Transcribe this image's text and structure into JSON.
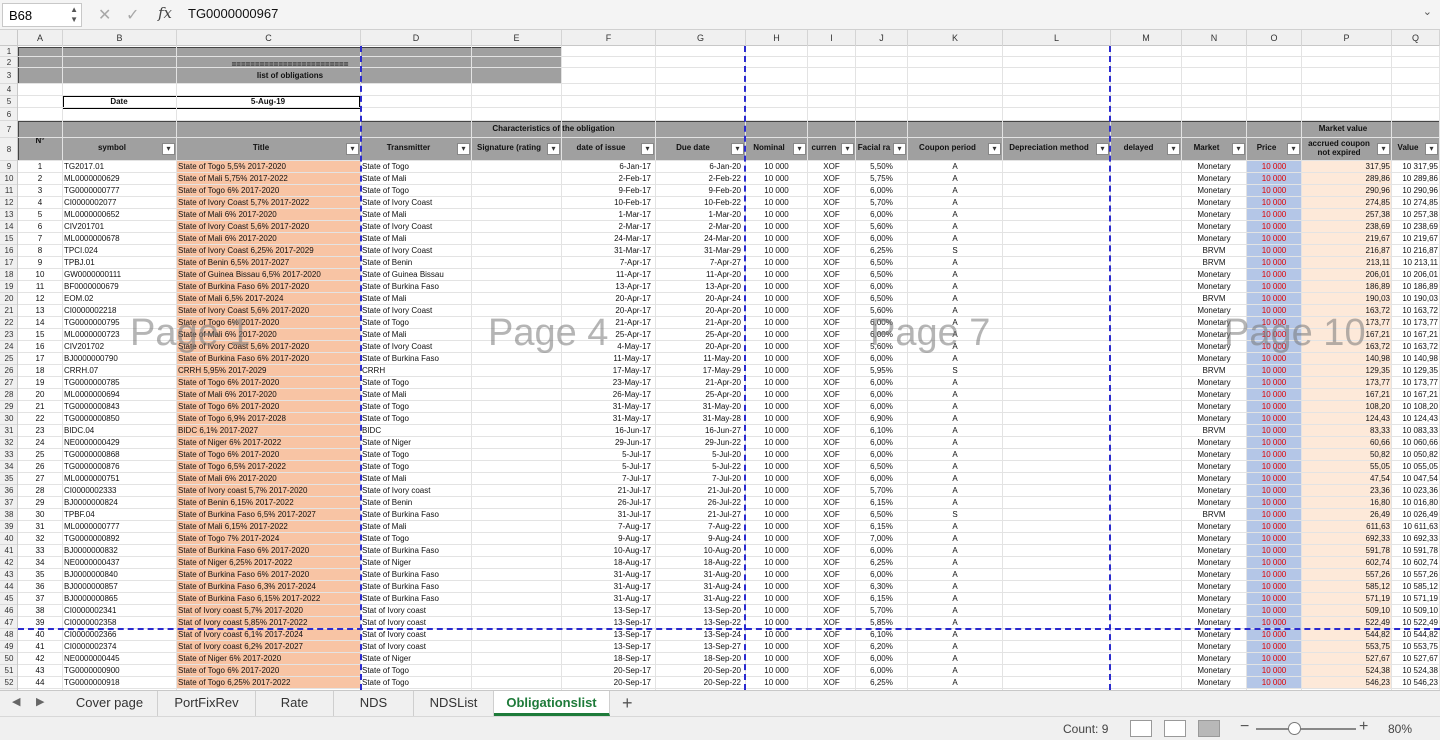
{
  "formula_bar": {
    "cell_ref": "B68",
    "fx_label": "fx",
    "value": "TG0000000967"
  },
  "columns": [
    "A",
    "B",
    "C",
    "D",
    "E",
    "F",
    "G",
    "H",
    "I",
    "J",
    "K",
    "L",
    "M",
    "N",
    "O",
    "P",
    "Q"
  ],
  "first_row": 1,
  "last_row": 52,
  "header": {
    "banner_line": "=========================",
    "banner_title": "list of obligations",
    "date_label": "Date",
    "date_value": "5-Aug-19",
    "no_label": "N°",
    "characteristics": "Characteristics of the obligation",
    "market_value": "Market value",
    "col_labels": [
      "symbol",
      "Title",
      "Transmitter",
      "Signature  (rating",
      "date of issue",
      "Due date",
      "Nominal",
      "curren",
      "Facial ra",
      "Coupon period",
      "Depreciation method",
      "delayed",
      "Market",
      "Price",
      "accrued coupon not expired",
      "Value"
    ]
  },
  "page_watermarks": [
    "Page 1",
    "Page 4",
    "Page 7",
    "Page 10"
  ],
  "rows": [
    [
      "1",
      "TG2017.01",
      "State of Togo 5,5% 2017-2020",
      "State of Togo",
      "6-Jan-17",
      "6-Jan-20",
      "10 000",
      "XOF",
      "5,50%",
      "A",
      "Monetary",
      "10 000",
      "317,95",
      "10 317,95"
    ],
    [
      "2",
      "ML0000000629",
      "State of Mali 5,75% 2017-2022",
      "State of Mali",
      "2-Feb-17",
      "2-Feb-22",
      "10 000",
      "XOF",
      "5,75%",
      "A",
      "Monetary",
      "10 000",
      "289,86",
      "10 289,86"
    ],
    [
      "3",
      "TG0000000777",
      "State of Togo 6% 2017-2020",
      "State of Togo",
      "9-Feb-17",
      "9-Feb-20",
      "10 000",
      "XOF",
      "6,00%",
      "A",
      "Monetary",
      "10 000",
      "290,96",
      "10 290,96"
    ],
    [
      "4",
      "CI0000002077",
      "State of Ivory Coast 5,7% 2017-2022",
      "State of Ivory Coast",
      "10-Feb-17",
      "10-Feb-22",
      "10 000",
      "XOF",
      "5,70%",
      "A",
      "Monetary",
      "10 000",
      "274,85",
      "10 274,85"
    ],
    [
      "5",
      "ML0000000652",
      "State of Mali 6% 2017-2020",
      "State of Mali",
      "1-Mar-17",
      "1-Mar-20",
      "10 000",
      "XOF",
      "6,00%",
      "A",
      "Monetary",
      "10 000",
      "257,38",
      "10 257,38"
    ],
    [
      "6",
      "CIV201701",
      "State of Ivory Coast 5,6% 2017-2020",
      "State of Ivory Coast",
      "2-Mar-17",
      "2-Mar-20",
      "10 000",
      "XOF",
      "5,60%",
      "A",
      "Monetary",
      "10 000",
      "238,69",
      "10 238,69"
    ],
    [
      "7",
      "ML0000000678",
      "State of Mali 6% 2017-2020",
      "State of Mali",
      "24-Mar-17",
      "24-Mar-20",
      "10 000",
      "XOF",
      "6,00%",
      "A",
      "Monetary",
      "10 000",
      "219,67",
      "10 219,67"
    ],
    [
      "8",
      "TPCI.024",
      "State of Ivory Coast 6,25% 2017-2029",
      "State of Ivory Coast",
      "31-Mar-17",
      "31-Mar-29",
      "10 000",
      "XOF",
      "6,25%",
      "S",
      "BRVM",
      "10 000",
      "216,87",
      "10 216,87"
    ],
    [
      "9",
      "TPBJ.01",
      "State of Benin 6,5% 2017-2027",
      "State of Benin",
      "7-Apr-17",
      "7-Apr-27",
      "10 000",
      "XOF",
      "6,50%",
      "A",
      "BRVM",
      "10 000",
      "213,11",
      "10 213,11"
    ],
    [
      "10",
      "GW0000000111",
      "State of Guinea Bissau 6,5% 2017-2020",
      "State of Guinea Bissau",
      "11-Apr-17",
      "11-Apr-20",
      "10 000",
      "XOF",
      "6,50%",
      "A",
      "Monetary",
      "10 000",
      "206,01",
      "10 206,01"
    ],
    [
      "11",
      "BF0000000679",
      "State of Burkina Faso 6% 2017-2020",
      "State of Burkina Faso",
      "13-Apr-17",
      "13-Apr-20",
      "10 000",
      "XOF",
      "6,00%",
      "A",
      "Monetary",
      "10 000",
      "186,89",
      "10 186,89"
    ],
    [
      "12",
      "EOM.02",
      "State of Mali 6,5% 2017-2024",
      "State of Mali",
      "20-Apr-17",
      "20-Apr-24",
      "10 000",
      "XOF",
      "6,50%",
      "A",
      "BRVM",
      "10 000",
      "190,03",
      "10 190,03"
    ],
    [
      "13",
      "CI0000002218",
      "State of Ivory Coast 5,6% 2017-2020",
      "State of Ivory Coast",
      "20-Apr-17",
      "20-Apr-20",
      "10 000",
      "XOF",
      "5,60%",
      "A",
      "Monetary",
      "10 000",
      "163,72",
      "10 163,72"
    ],
    [
      "14",
      "TG0000000795",
      "State of Togo 6% 2017-2020",
      "State of Togo",
      "21-Apr-17",
      "21-Apr-20",
      "10 000",
      "XOF",
      "6,00%",
      "A",
      "Monetary",
      "10 000",
      "173,77",
      "10 173,77"
    ],
    [
      "15",
      "ML0000000723",
      "State of Mali 6% 2017-2020",
      "State of Mali",
      "25-Apr-17",
      "25-Apr-20",
      "10 000",
      "XOF",
      "6,00%",
      "A",
      "Monetary",
      "10 000",
      "167,21",
      "10 167,21"
    ],
    [
      "16",
      "CIV201702",
      "State of Ivory Coast 5,6% 2017-2020",
      "State of Ivory Coast",
      "4-May-17",
      "20-Apr-20",
      "10 000",
      "XOF",
      "5,60%",
      "A",
      "Monetary",
      "10 000",
      "163,72",
      "10 163,72"
    ],
    [
      "17",
      "BJ0000000790",
      "State of Burkina Faso 6% 2017-2020",
      "State of Burkina Faso",
      "11-May-17",
      "11-May-20",
      "10 000",
      "XOF",
      "6,00%",
      "A",
      "Monetary",
      "10 000",
      "140,98",
      "10 140,98"
    ],
    [
      "18",
      "CRRH.07",
      "CRRH 5,95% 2017-2029",
      "CRRH",
      "17-May-17",
      "17-May-29",
      "10 000",
      "XOF",
      "5,95%",
      "S",
      "BRVM",
      "10 000",
      "129,35",
      "10 129,35"
    ],
    [
      "19",
      "TG0000000785",
      "State of Togo 6% 2017-2020",
      "State of Togo",
      "23-May-17",
      "21-Apr-20",
      "10 000",
      "XOF",
      "6,00%",
      "A",
      "Monetary",
      "10 000",
      "173,77",
      "10 173,77"
    ],
    [
      "20",
      "ML0000000694",
      "State of Mali 6% 2017-2020",
      "State of Mali",
      "26-May-17",
      "25-Apr-20",
      "10 000",
      "XOF",
      "6,00%",
      "A",
      "Monetary",
      "10 000",
      "167,21",
      "10 167,21"
    ],
    [
      "21",
      "TG0000000843",
      "State of  Togo 6% 2017-2020",
      "State of  Togo",
      "31-May-17",
      "31-May-20",
      "10 000",
      "XOF",
      "6,00%",
      "A",
      "Monetary",
      "10 000",
      "108,20",
      "10 108,20"
    ],
    [
      "22",
      "TG0000000850",
      "State of Togo 6,9% 2017-2028",
      "State of Togo",
      "31-May-17",
      "31-May-28",
      "10 000",
      "XOF",
      "6,90%",
      "A",
      "Monetary",
      "10 000",
      "124,43",
      "10 124,43"
    ],
    [
      "23",
      "BIDC.04",
      "BIDC 6,1% 2017-2027",
      "BIDC",
      "16-Jun-17",
      "16-Jun-27",
      "10 000",
      "XOF",
      "6,10%",
      "A",
      "BRVM",
      "10 000",
      "83,33",
      "10 083,33"
    ],
    [
      "24",
      "NE0000000429",
      "State of Niger 6% 2017-2022",
      "State of Niger",
      "29-Jun-17",
      "29-Jun-22",
      "10 000",
      "XOF",
      "6,00%",
      "A",
      "Monetary",
      "10 000",
      "60,66",
      "10 060,66"
    ],
    [
      "25",
      "TG0000000868",
      "State of Togo 6% 2017-2020",
      "State of Togo",
      "5-Jul-17",
      "5-Jul-20",
      "10 000",
      "XOF",
      "6,00%",
      "A",
      "Monetary",
      "10 000",
      "50,82",
      "10 050,82"
    ],
    [
      "26",
      "TG0000000876",
      "State of Togo 6,5% 2017-2022",
      "State of Togo",
      "5-Jul-17",
      "5-Jul-22",
      "10 000",
      "XOF",
      "6,50%",
      "A",
      "Monetary",
      "10 000",
      "55,05",
      "10 055,05"
    ],
    [
      "27",
      "ML0000000751",
      "State of Mali 6% 2017-2020",
      "State of Mali",
      "7-Jul-17",
      "7-Jul-20",
      "10 000",
      "XOF",
      "6,00%",
      "A",
      "Monetary",
      "10 000",
      "47,54",
      "10 047,54"
    ],
    [
      "28",
      "CI0000002333",
      "State of Ivory coast 5,7% 2017-2020",
      "State of Ivory coast",
      "21-Jul-17",
      "21-Jul-20",
      "10 000",
      "XOF",
      "5,70%",
      "A",
      "Monetary",
      "10 000",
      "23,36",
      "10 023,36"
    ],
    [
      "29",
      "BJ0000000824",
      "State of Benin 6,15% 2017-2022",
      "State of Benin",
      "26-Jul-17",
      "26-Jul-22",
      "10 000",
      "XOF",
      "6,15%",
      "A",
      "Monetary",
      "10 000",
      "16,80",
      "10 016,80"
    ],
    [
      "30",
      "TPBF.04",
      "State of Burkina Faso 6,5% 2017-2027",
      "State of Burkina Faso",
      "31-Jul-17",
      "21-Jul-27",
      "10 000",
      "XOF",
      "6,50%",
      "S",
      "BRVM",
      "10 000",
      "26,49",
      "10 026,49"
    ],
    [
      "31",
      "ML0000000777",
      "State of Mali 6,15% 2017-2022",
      "State of Mali",
      "7-Aug-17",
      "7-Aug-22",
      "10 000",
      "XOF",
      "6,15%",
      "A",
      "Monetary",
      "10 000",
      "611,63",
      "10 611,63"
    ],
    [
      "32",
      "TG0000000892",
      "State of Togo 7% 2017-2024",
      "State of Togo",
      "9-Aug-17",
      "9-Aug-24",
      "10 000",
      "XOF",
      "7,00%",
      "A",
      "Monetary",
      "10 000",
      "692,33",
      "10 692,33"
    ],
    [
      "33",
      "BJ0000000832",
      "State of Burkina Faso 6% 2017-2020",
      "State of Burkina Faso",
      "10-Aug-17",
      "10-Aug-20",
      "10 000",
      "XOF",
      "6,00%",
      "A",
      "Monetary",
      "10 000",
      "591,78",
      "10 591,78"
    ],
    [
      "34",
      "NE0000000437",
      "State of Niger 6,25% 2017-2022",
      "State of Niger",
      "18-Aug-17",
      "18-Aug-22",
      "10 000",
      "XOF",
      "6,25%",
      "A",
      "Monetary",
      "10 000",
      "602,74",
      "10 602,74"
    ],
    [
      "35",
      "BJ0000000840",
      "State of Burkina Faso 6% 2017-2020",
      "State of Burkina Faso",
      "31-Aug-17",
      "31-Aug-20",
      "10 000",
      "XOF",
      "6,00%",
      "A",
      "Monetary",
      "10 000",
      "557,26",
      "10 557,26"
    ],
    [
      "36",
      "BJ0000000857",
      "State of Burkina Faso 6,3% 2017-2024",
      "State of Burkina Faso",
      "31-Aug-17",
      "31-Aug-24",
      "10 000",
      "XOF",
      "6,30%",
      "A",
      "Monetary",
      "10 000",
      "585,12",
      "10 585,12"
    ],
    [
      "37",
      "BJ0000000865",
      "State of Burkina Faso 6,15% 2017-2022",
      "State of Burkina Faso",
      "31-Aug-17",
      "31-Aug-22",
      "10 000",
      "XOF",
      "6,15%",
      "A",
      "Monetary",
      "10 000",
      "571,19",
      "10 571,19"
    ],
    [
      "38",
      "CI0000002341",
      "Stat of Ivory coast 5,7% 2017-2020",
      "Stat of Ivory coast",
      "13-Sep-17",
      "13-Sep-20",
      "10 000",
      "XOF",
      "5,70%",
      "A",
      "Monetary",
      "10 000",
      "509,10",
      "10 509,10"
    ],
    [
      "39",
      "CI0000002358",
      "Stat of Ivory coast 5,85% 2017-2022",
      "Stat of Ivory coast",
      "13-Sep-17",
      "13-Sep-22",
      "10 000",
      "XOF",
      "5,85%",
      "A",
      "Monetary",
      "10 000",
      "522,49",
      "10 522,49"
    ],
    [
      "40",
      "CI0000002366",
      "Stat of Ivory coast 6,1% 2017-2024",
      "Stat of Ivory coast",
      "13-Sep-17",
      "13-Sep-24",
      "10 000",
      "XOF",
      "6,10%",
      "A",
      "Monetary",
      "10 000",
      "544,82",
      "10 544,82"
    ],
    [
      "41",
      "CI0000002374",
      "Stat of Ivory coast 6,2% 2017-2027",
      "Stat of Ivory coast",
      "13-Sep-17",
      "13-Sep-27",
      "10 000",
      "XOF",
      "6,20%",
      "A",
      "Monetary",
      "10 000",
      "553,75",
      "10 553,75"
    ],
    [
      "42",
      "NE0000000445",
      "State of Niger 6% 2017-2020",
      "State of Niger",
      "18-Sep-17",
      "18-Sep-20",
      "10 000",
      "XOF",
      "6,00%",
      "A",
      "Monetary",
      "10 000",
      "527,67",
      "10 527,67"
    ],
    [
      "43",
      "TG0000000900",
      "State of Togo 6% 2017-2020",
      "State of Togo",
      "20-Sep-17",
      "20-Sep-20",
      "10 000",
      "XOF",
      "6,00%",
      "A",
      "Monetary",
      "10 000",
      "524,38",
      "10 524,38"
    ],
    [
      "44",
      "TG0000000918",
      "State of Togo 6,25% 2017-2022",
      "State of Togo",
      "20-Sep-17",
      "20-Sep-22",
      "10 000",
      "XOF",
      "6,25%",
      "A",
      "Monetary",
      "10 000",
      "546,23",
      "10 546,23"
    ]
  ],
  "tabs": [
    "Cover page",
    "PortFixRev",
    "Rate",
    "NDS",
    "NDSList",
    "Obligationslist"
  ],
  "active_tab": "Obligationslist",
  "status": {
    "count": "Count: 9",
    "zoom": "80%"
  },
  "colors": {
    "title_fill": "#f8c4a4",
    "price_fill": "#b4c6e7",
    "price_text": "#e00000",
    "header_gray": "#a0a0a0",
    "page_break": "#2b2bd0",
    "active_tab": "#1e7b3a"
  },
  "icons": [
    "spin-icon",
    "cancel-icon",
    "enter-icon",
    "fx-icon",
    "dropdown-icon",
    "filter-icon",
    "prev-sheet-icon",
    "next-sheet-icon",
    "add-sheet-icon",
    "normal-view-icon",
    "page-layout-icon",
    "page-break-view-icon"
  ]
}
